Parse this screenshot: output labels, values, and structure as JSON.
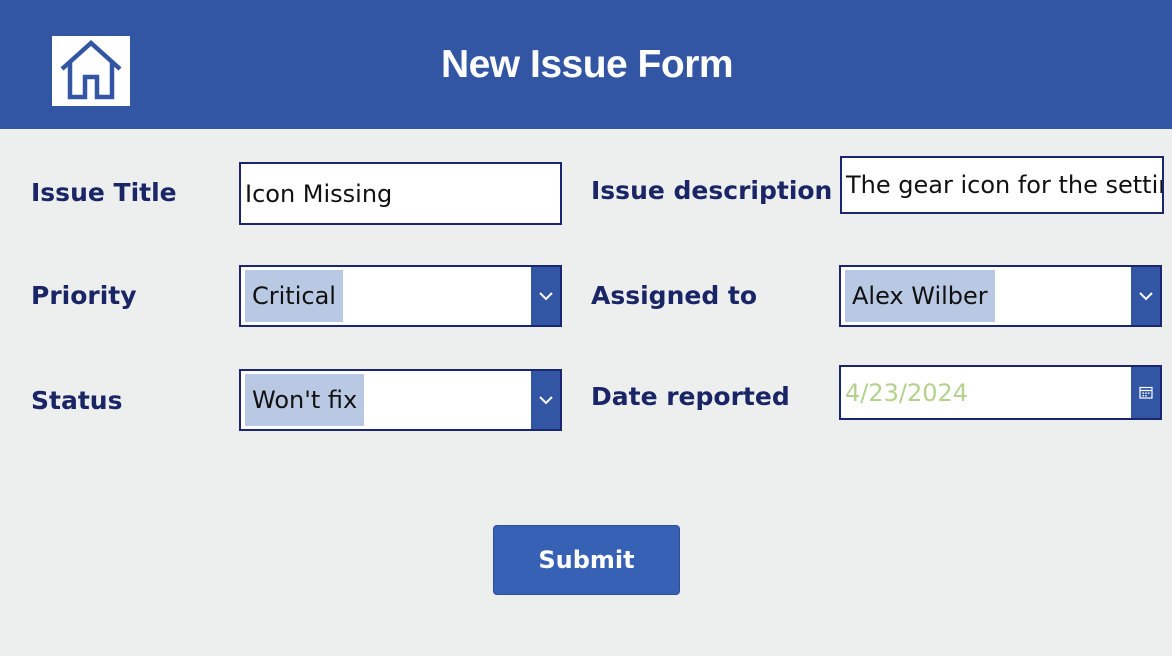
{
  "header": {
    "title": "New Issue Form",
    "home_icon": "home-icon",
    "background_color": "#3256a4"
  },
  "form": {
    "issue_title": {
      "label": "Issue Title",
      "value": "Icon Missing"
    },
    "issue_description": {
      "label": "Issue description",
      "value": "The gear icon for the settin"
    },
    "priority": {
      "label": "Priority",
      "value": "Critical"
    },
    "assigned_to": {
      "label": "Assigned to",
      "value": "Alex Wilber"
    },
    "status": {
      "label": "Status",
      "value": "Won't fix"
    },
    "date_reported": {
      "label": "Date reported",
      "value": "4/23/2024",
      "icon": "calendar-icon"
    }
  },
  "submit": {
    "label": "Submit"
  },
  "colors": {
    "accent": "#3256a4",
    "label_text": "#1a2566",
    "selection_highlight": "#b9c8e3",
    "date_text": "#b4d18e"
  }
}
